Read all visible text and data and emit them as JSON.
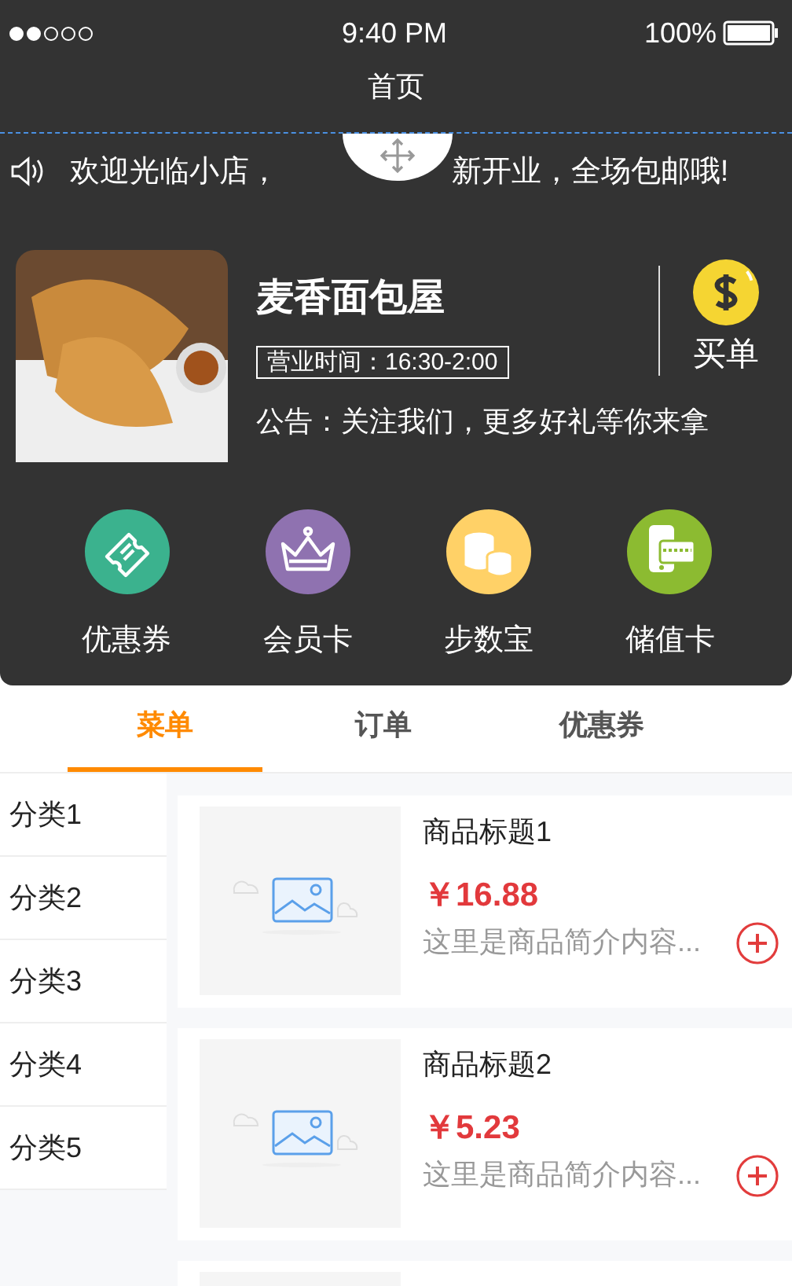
{
  "status_bar": {
    "signal_dots": [
      {
        "on": true
      },
      {
        "on": true
      },
      {
        "on": false
      },
      {
        "on": false
      },
      {
        "on": false
      }
    ],
    "time": "9:40 PM",
    "battery": "100%"
  },
  "nav": {
    "title": "首页"
  },
  "notice": {
    "before": "欢迎光临小店，",
    "after": "新开业，全场包邮哦!"
  },
  "shop": {
    "name": "麦香面包屋",
    "hours": "营业时间：16:30-2:00",
    "announcement": "公告：关注我们，更多好礼等你来拿",
    "pay_label": "买单"
  },
  "shortcuts": [
    {
      "label": "优惠券",
      "kind": "ticket",
      "color": "#3bb28e"
    },
    {
      "label": "会员卡",
      "kind": "crown",
      "color": "#8f72b0"
    },
    {
      "label": "步数宝",
      "kind": "coins",
      "color": "#ffd167"
    },
    {
      "label": "储值卡",
      "kind": "card",
      "color": "#8cbb31"
    }
  ],
  "tabs": [
    {
      "label": "菜单",
      "selected": true
    },
    {
      "label": "订单",
      "selected": false
    },
    {
      "label": "优惠券",
      "selected": false
    }
  ],
  "categories": [
    {
      "label": "分类1",
      "selected": false
    },
    {
      "label": "分类2",
      "selected": false
    },
    {
      "label": "分类3",
      "selected": false
    },
    {
      "label": "分类4",
      "selected": false
    },
    {
      "label": "分类5",
      "selected": false
    }
  ],
  "products": [
    {
      "title": "商品标题1",
      "price": "￥16.88",
      "description": "这里是商品简介内容..."
    },
    {
      "title": "商品标题2",
      "price": "￥5.23",
      "description": "这里是商品简介内容..."
    }
  ]
}
